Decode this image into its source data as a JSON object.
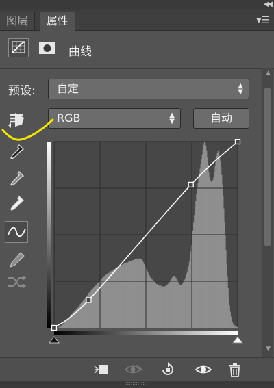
{
  "tabs": [
    {
      "label": "图层",
      "active": false
    },
    {
      "label": "属性",
      "active": true
    }
  ],
  "icons": {
    "collapse": "double-chevron-left-icon",
    "panel_menu": "panel-menu-icon",
    "adjustment": "curves-adjustment-icon",
    "mask": "layer-mask-icon"
  },
  "header": {
    "title": "曲线"
  },
  "preset": {
    "label": "预设:",
    "value": "自定"
  },
  "channel": {
    "value": "RGB"
  },
  "auto_button": {
    "label": "自动"
  },
  "tools": [
    {
      "name": "target-adjust-icon"
    },
    {
      "name": "black-eyedropper-icon"
    },
    {
      "name": "gray-eyedropper-icon"
    },
    {
      "name": "white-eyedropper-icon"
    },
    {
      "name": "curve-edit-icon",
      "active": true
    },
    {
      "name": "pencil-icon"
    },
    {
      "name": "smooth-curve-icon"
    }
  ],
  "bottom_bar": [
    {
      "name": "clip-to-layer-icon"
    },
    {
      "name": "view-previous-state-icon"
    },
    {
      "name": "reset-icon"
    },
    {
      "name": "toggle-visibility-icon"
    },
    {
      "name": "delete-icon"
    }
  ],
  "colors": {
    "panel_bg": "#535353",
    "graph_bg": "#474747",
    "histogram": "#8f8f8f",
    "curve": "#ffffff",
    "annotation": "#f2e600"
  },
  "chart_data": {
    "type": "line",
    "xlim": [
      0,
      255
    ],
    "ylim": [
      0,
      255
    ],
    "grid": "4x4",
    "curve_points": [
      {
        "x": 0,
        "y": 0
      },
      {
        "x": 48,
        "y": 38
      },
      {
        "x": 190,
        "y": 196
      },
      {
        "x": 255,
        "y": 255
      }
    ],
    "histogram": [
      0,
      0,
      0,
      0,
      0,
      0,
      1,
      1,
      2,
      2,
      3,
      4,
      5,
      6,
      7,
      8,
      9,
      10,
      11,
      12,
      13,
      14,
      15,
      16,
      17,
      18,
      19,
      20,
      21,
      22,
      23,
      24,
      25,
      26,
      27,
      28,
      30,
      31,
      32,
      33,
      34,
      35,
      36,
      38,
      39,
      40,
      41,
      42,
      44,
      45,
      46,
      47,
      48,
      49,
      50,
      51,
      52,
      53,
      54,
      55,
      56,
      57,
      58,
      59,
      60,
      61,
      62,
      63,
      64,
      64,
      65,
      66,
      67,
      67,
      68,
      69,
      69,
      70,
      71,
      71,
      72,
      72,
      73,
      74,
      74,
      75,
      75,
      76,
      76,
      77,
      77,
      78,
      78,
      79,
      79,
      80,
      80,
      81,
      81,
      81,
      82,
      82,
      82,
      83,
      83,
      84,
      84,
      84,
      85,
      85,
      85,
      86,
      86,
      86,
      86,
      87,
      87,
      87,
      87,
      87,
      87,
      86,
      85,
      84,
      82,
      80,
      78,
      76,
      74,
      72,
      70,
      68,
      66,
      64,
      63,
      62,
      61,
      60,
      59,
      58,
      57,
      56,
      55,
      55,
      54,
      54,
      53,
      53,
      53,
      52,
      52,
      52,
      52,
      52,
      52,
      53,
      53,
      54,
      55,
      56,
      57,
      58,
      60,
      62,
      63,
      64,
      65,
      65,
      64,
      63,
      62,
      60,
      58,
      56,
      55,
      54,
      54,
      54,
      55,
      56,
      58,
      60,
      62,
      64,
      67,
      70,
      74,
      78,
      83,
      89,
      96,
      104,
      113,
      122,
      132,
      142,
      152,
      160,
      168,
      175,
      182,
      188,
      194,
      200,
      206,
      212,
      218,
      224,
      230,
      234,
      232,
      228,
      222,
      214,
      205,
      196,
      190,
      186,
      184,
      183,
      184,
      186,
      190,
      196,
      203,
      210,
      216,
      220,
      222,
      220,
      216,
      210,
      202,
      192,
      180,
      166,
      150,
      133,
      116,
      98,
      80,
      64,
      50,
      38,
      28,
      20,
      14,
      10,
      7,
      5,
      4,
      3,
      2,
      2,
      1,
      1
    ]
  }
}
